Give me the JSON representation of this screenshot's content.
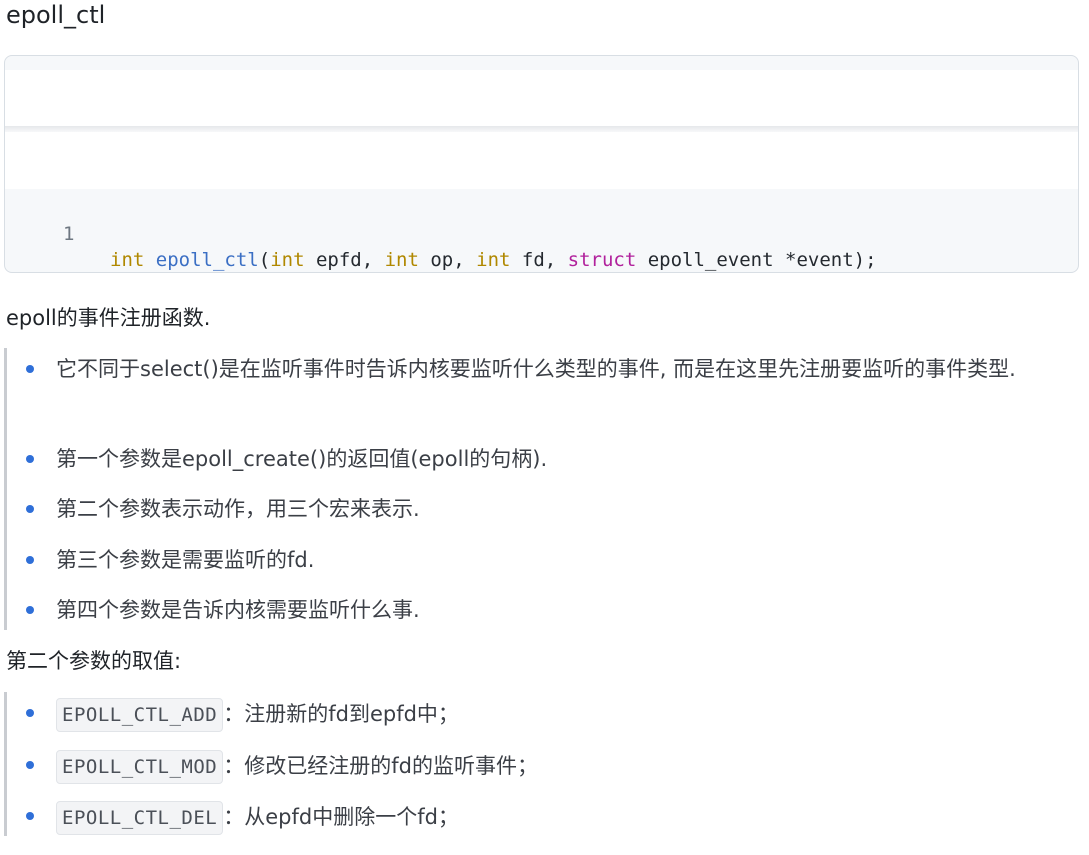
{
  "heading": "epoll_ctl",
  "code": {
    "line_number": "1",
    "tokens": {
      "t1": "int",
      "t2": " ",
      "t3": "epoll_ctl",
      "t4": "(",
      "t5": "int",
      "t6": " epfd, ",
      "t7": "int",
      "t8": " op, ",
      "t9": "int",
      "t10": " fd, ",
      "t11": "struct",
      "t12": " epoll_event *event);"
    }
  },
  "intro": "epoll的事件注册函数.",
  "params_list": [
    "它不同于select()是在监听事件时告诉内核要监听什么类型的事件, 而是在这里先注册要监听的事件类型.",
    "第一个参数是epoll_create()的返回值(epoll的句柄).",
    "第二个参数表示动作，用三个宏来表示.",
    "第三个参数是需要监听的fd.",
    "第四个参数是告诉内核需要监听什么事."
  ],
  "op_heading": "第二个参数的取值:",
  "op_values": [
    {
      "code": "EPOLL_CTL_ADD",
      "desc": "：注册新的fd到epfd中；"
    },
    {
      "code": "EPOLL_CTL_MOD",
      "desc": "：修改已经注册的fd的监听事件；"
    },
    {
      "code": "EPOLL_CTL_DEL",
      "desc": "：从epfd中删除一个fd；"
    }
  ],
  "colors": {
    "bullet": "#2f6fd8",
    "keyword_type": "#b08800",
    "function_name": "#3b6fc4",
    "keyword_struct": "#b1219c"
  }
}
